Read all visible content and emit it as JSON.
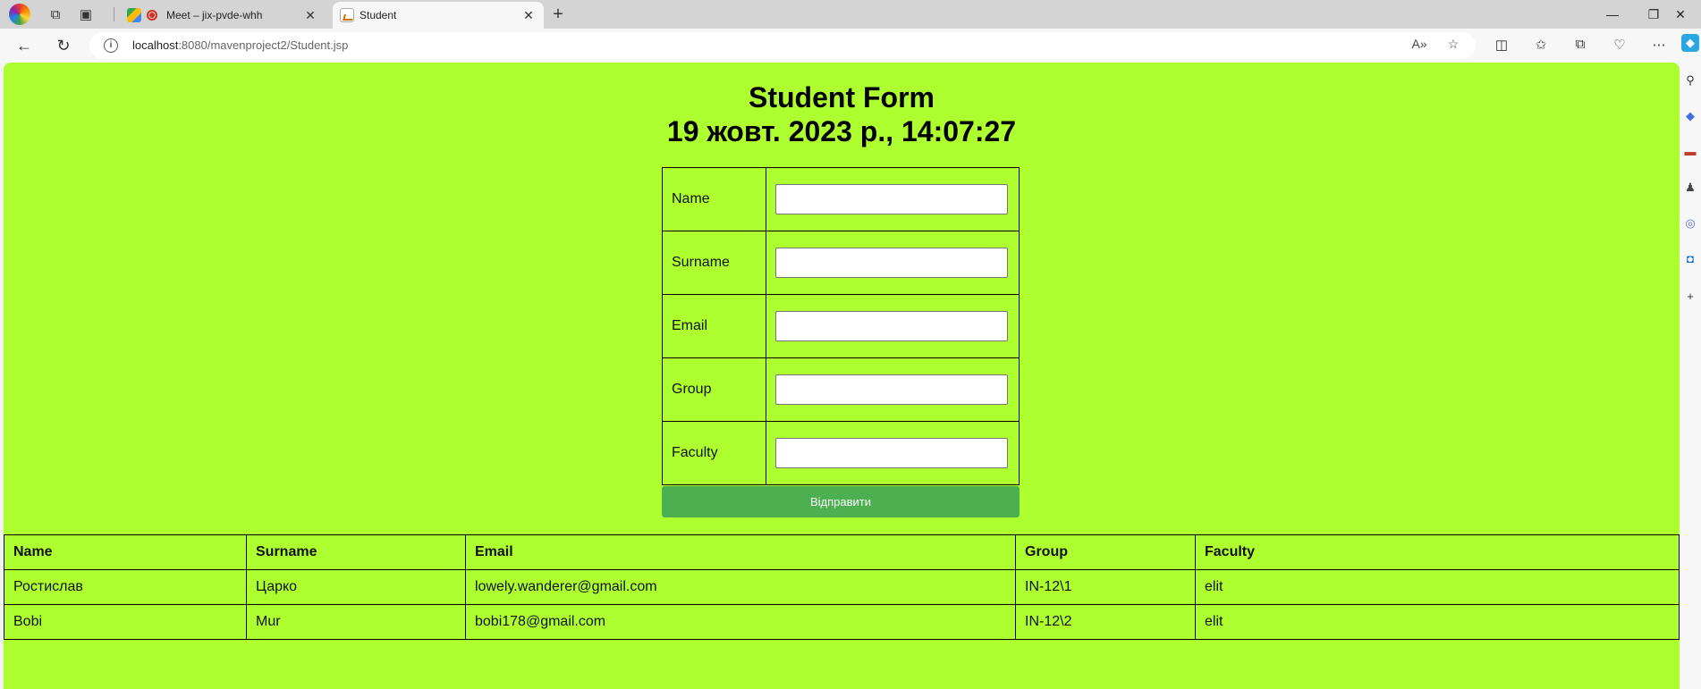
{
  "browser": {
    "tabs": [
      {
        "title": "Meet – jix-pvde-whh"
      },
      {
        "title": "Student"
      }
    ],
    "new_tab": "+",
    "address": {
      "host": "localhost",
      "path": ":8080/mavenproject2/Student.jsp"
    }
  },
  "page": {
    "title": "Student Form",
    "datetime": "19 жовт. 2023 р., 14:07:27",
    "form": {
      "fields": [
        {
          "label": "Name",
          "value": ""
        },
        {
          "label": "Surname",
          "value": ""
        },
        {
          "label": "Email",
          "value": ""
        },
        {
          "label": "Group",
          "value": ""
        },
        {
          "label": "Faculty",
          "value": ""
        }
      ],
      "submit_label": "Відправити"
    },
    "table": {
      "headers": [
        "Name",
        "Surname",
        "Email",
        "Group",
        "Faculty"
      ],
      "rows": [
        [
          "Ростислав",
          "Царко",
          "lowely.wanderer@gmail.com",
          "IN-12\\1",
          "elit"
        ],
        [
          "Bobi",
          "Mur",
          "bobi178@gmail.com",
          "IN-12\\2",
          "elit"
        ]
      ]
    }
  },
  "colors": {
    "page_background": "#adff2f",
    "submit_button": "#4caf50"
  }
}
